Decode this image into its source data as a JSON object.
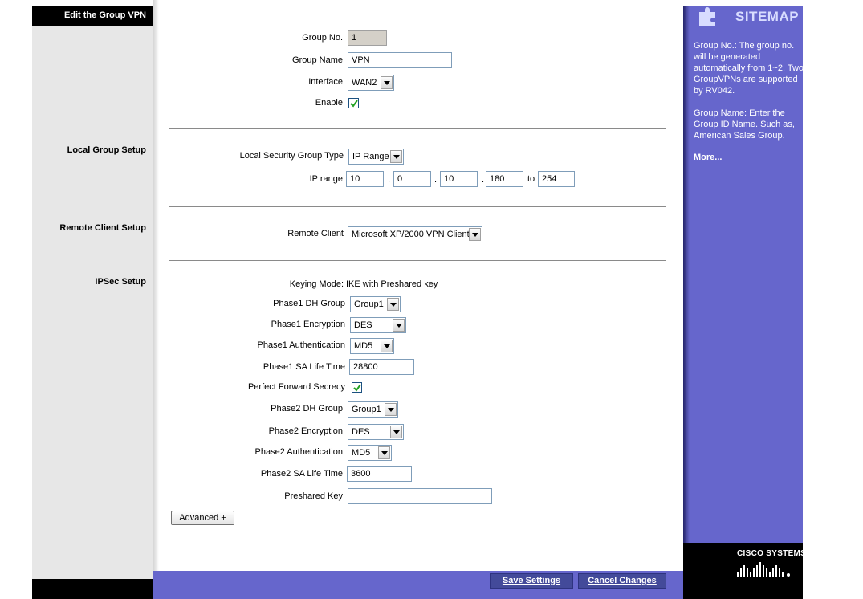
{
  "left": {
    "header": "Edit the Group VPN",
    "sections": {
      "local_group": "Local Group Setup",
      "remote_client": "Remote Client Setup",
      "ipsec": "IPSec Setup"
    }
  },
  "form": {
    "group_no": {
      "label": "Group No.",
      "value": "1"
    },
    "group_name": {
      "label": "Group Name",
      "value": "VPN"
    },
    "interface": {
      "label": "Interface",
      "value": "WAN2"
    },
    "enable": {
      "label": "Enable",
      "checked": true
    },
    "local_type": {
      "label": "Local Security Group Type",
      "value": "IP Range"
    },
    "ip_range": {
      "label": "IP range",
      "oct1": "10",
      "oct2": "0",
      "oct3": "10",
      "oct4": "180",
      "to_label": "to",
      "end": "254"
    },
    "remote_client": {
      "label": "Remote Client",
      "value": "Microsoft XP/2000 VPN Client"
    },
    "keying_mode": {
      "label": "Keying Mode:",
      "value": "IKE with Preshared key"
    },
    "p1_dh": {
      "label": "Phase1 DH Group",
      "value": "Group1"
    },
    "p1_enc": {
      "label": "Phase1 Encryption",
      "value": "DES"
    },
    "p1_auth": {
      "label": "Phase1 Authentication",
      "value": "MD5"
    },
    "p1_life": {
      "label": "Phase1 SA Life Time",
      "value": "28800"
    },
    "pfs": {
      "label": "Perfect Forward Secrecy",
      "checked": true
    },
    "p2_dh": {
      "label": "Phase2 DH Group",
      "value": "Group1"
    },
    "p2_enc": {
      "label": "Phase2 Encryption",
      "value": "DES"
    },
    "p2_auth": {
      "label": "Phase2 Authentication",
      "value": "MD5"
    },
    "p2_life": {
      "label": "Phase2 SA Life Time",
      "value": "3600"
    },
    "preshared": {
      "label": "Preshared Key",
      "value": ""
    },
    "advanced_label": "Advanced +"
  },
  "footer": {
    "save": "Save Settings",
    "cancel": "Cancel Changes"
  },
  "sitemap": {
    "title": "SITEMAP",
    "help1": "Group No.: The group no. will be generated automatically from 1~2. Two GroupVPNs are supported by RV042.",
    "help2": "Group Name: Enter the Group ID Name. Such as, American Sales Group.",
    "more": "More...",
    "logo": "CISCO SYSTEMS"
  },
  "colors": {
    "accent": "#6666cc",
    "button": "#434a9a",
    "left_bg": "#e7e7e7"
  }
}
